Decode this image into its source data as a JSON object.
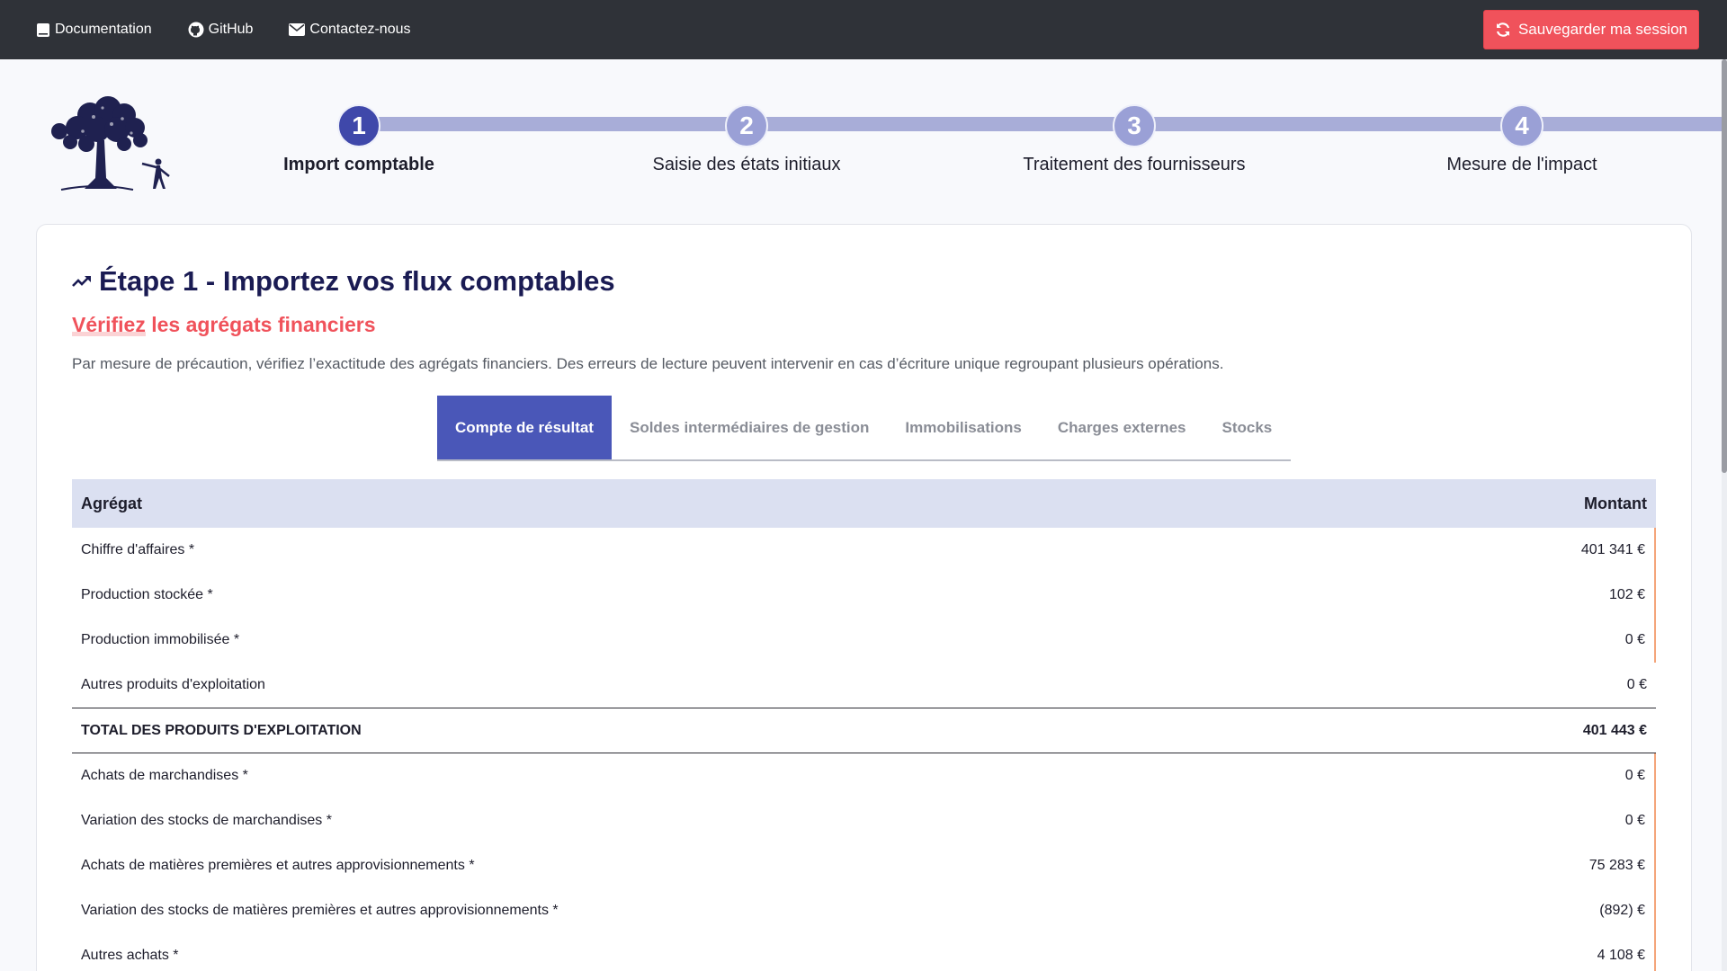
{
  "nav": {
    "links": [
      {
        "label": "Documentation",
        "icon": "book-icon"
      },
      {
        "label": "GitHub",
        "icon": "github-icon"
      },
      {
        "label": "Contactez-nous",
        "icon": "envelope-icon"
      }
    ],
    "save_label": "Sauvegarder ma session"
  },
  "stepper": {
    "steps": [
      {
        "number": "1",
        "label": "Import comptable",
        "active": true
      },
      {
        "number": "2",
        "label": "Saisie des états initiaux",
        "active": false
      },
      {
        "number": "3",
        "label": "Traitement des fournisseurs",
        "active": false
      },
      {
        "number": "4",
        "label": "Mesure de l'impact",
        "active": false
      }
    ]
  },
  "card": {
    "title": "Étape 1 - Importez vos flux comptables",
    "subtitle_underlined": "Vérifiez",
    "subtitle_rest": " les agrégats financiers",
    "description": "Par mesure de précaution, vérifiez l’exactitude des agrégats financiers. Des erreurs de lecture peuvent intervenir en cas d’écriture unique regroupant plusieurs opérations."
  },
  "tabs": [
    {
      "label": "Compte de résultat",
      "active": true
    },
    {
      "label": "Soldes intermédiaires de gestion",
      "active": false
    },
    {
      "label": "Immobilisations",
      "active": false
    },
    {
      "label": "Charges externes",
      "active": false
    },
    {
      "label": "Stocks",
      "active": false
    }
  ],
  "table": {
    "headers": {
      "label": "Agrégat",
      "amount": "Montant"
    },
    "rows": [
      {
        "label": "Chiffre d'affaires *",
        "amount": "401 341 €"
      },
      {
        "label": "Production stockée *",
        "amount": "102 €"
      },
      {
        "label": "Production immobilisée *",
        "amount": "0 €"
      },
      {
        "label": "Autres produits d'exploitation",
        "amount": "0 €"
      },
      {
        "label": "TOTAL DES PRODUITS D'EXPLOITATION",
        "amount": "401 443 €"
      },
      {
        "label": "Achats de marchandises *",
        "amount": "0 €"
      },
      {
        "label": "Variation des stocks de marchandises *",
        "amount": "0 €"
      },
      {
        "label": "Achats de matières premières et autres approvisionnements *",
        "amount": "75 283 €"
      },
      {
        "label": "Variation des stocks de matières premières et autres approvisionnements *",
        "amount": "(892) €"
      },
      {
        "label": "Autres achats *",
        "amount": "4 108 €"
      }
    ]
  },
  "colors": {
    "navbar": "#2f3238",
    "accent": "#f0525b",
    "primary": "#4a57b8",
    "step_active": "#3f48aa",
    "step_inactive": "#9aa0d6",
    "title": "#1a1b53"
  }
}
